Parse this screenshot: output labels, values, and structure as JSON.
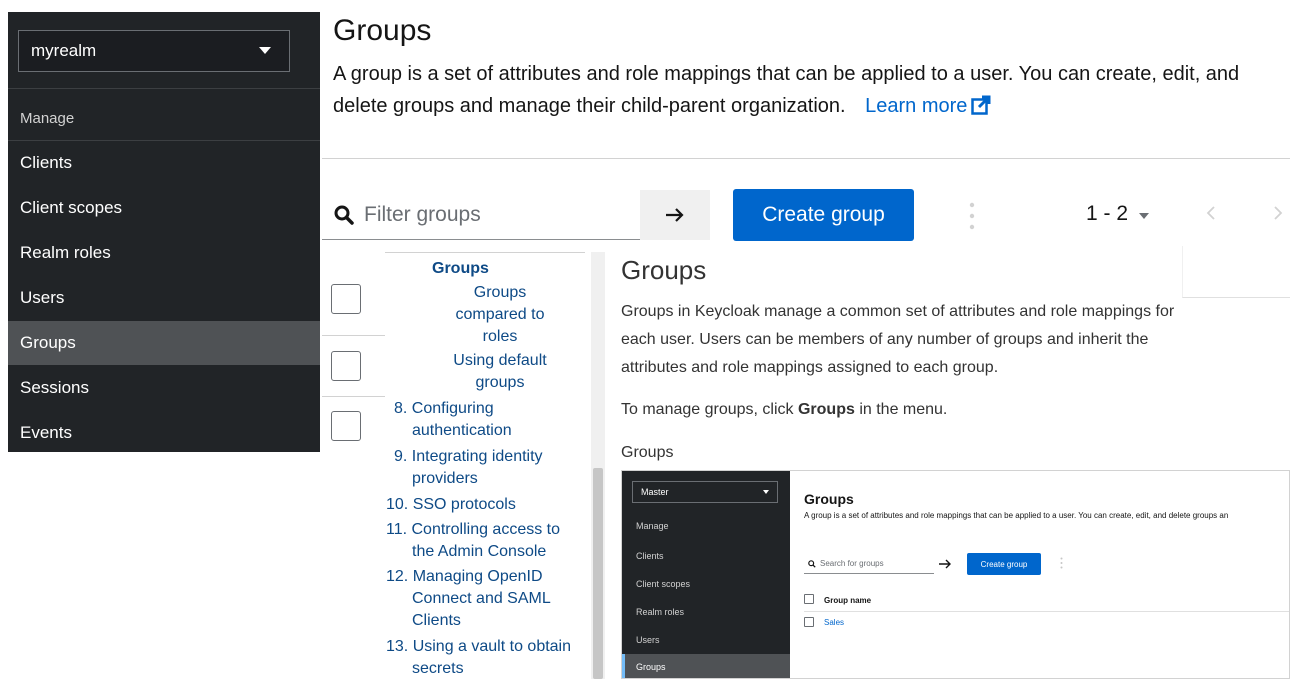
{
  "nav": {
    "realm": "myrealm",
    "section": "Manage",
    "items": [
      {
        "label": "Clients",
        "active": false
      },
      {
        "label": "Client scopes",
        "active": false
      },
      {
        "label": "Realm roles",
        "active": false
      },
      {
        "label": "Users",
        "active": false
      },
      {
        "label": "Groups",
        "active": true
      },
      {
        "label": "Sessions",
        "active": false
      },
      {
        "label": "Events",
        "active": false
      }
    ]
  },
  "header": {
    "title": "Groups",
    "description": "A group is a set of attributes and role mappings that can be applied to a user. You can create, edit, and delete groups and manage their child-parent organization.",
    "learn_more": "Learn more"
  },
  "toolbar": {
    "filter_placeholder": "Filter groups",
    "create_label": "Create group",
    "pagination": "1 - 2"
  },
  "toc": {
    "items": [
      {
        "label": "Groups",
        "bold": true
      },
      {
        "label": "Groups compared to roles",
        "bold": false
      },
      {
        "label": "Using default groups",
        "bold": false
      },
      {
        "label": "8. Configuring authentication",
        "bold": false
      },
      {
        "label": "9. Integrating identity providers",
        "bold": false
      },
      {
        "label": "10. SSO protocols",
        "bold": false
      },
      {
        "label": "11. Controlling access to the Admin Console",
        "bold": false
      },
      {
        "label": "12. Managing OpenID Connect and SAML Clients",
        "bold": false
      },
      {
        "label": "13. Using a vault to obtain secrets",
        "bold": false
      }
    ]
  },
  "doc": {
    "heading": "Groups",
    "paragraph1": "Groups in Keycloak manage a common set of attributes and role mappings for each user. Users can be members of any number of groups and inherit the attributes and role mappings assigned to each group.",
    "paragraph2_prefix": "To manage groups, click ",
    "paragraph2_bold": "Groups",
    "paragraph2_suffix": " in the menu.",
    "caption": "Groups"
  },
  "screenshot": {
    "realm": "Master",
    "section": "Manage",
    "nav_items": [
      "Clients",
      "Client scopes",
      "Realm roles",
      "Users",
      "Groups"
    ],
    "active_item": "Groups",
    "title": "Groups",
    "description": "A group is a set of attributes and role mappings that can be applied to a user. You can create, edit, and delete groups an",
    "search_placeholder": "Search for groups",
    "create_label": "Create group",
    "column_header": "Group name",
    "row": "Sales"
  },
  "colors": {
    "nav_bg": "#212427",
    "nav_active": "#4f5255",
    "primary": "#0066cc",
    "toc_link": "#0e4a86"
  }
}
